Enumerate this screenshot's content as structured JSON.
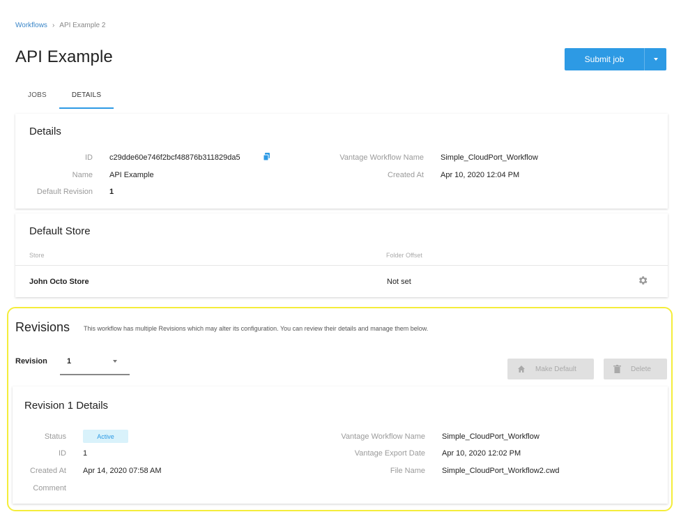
{
  "breadcrumb": {
    "parent": "Workflows",
    "separator": "›",
    "current": "API Example 2"
  },
  "page": {
    "title": "API Example"
  },
  "actions": {
    "submit_label": "Submit job"
  },
  "tabs": [
    {
      "label": "JOBS"
    },
    {
      "label": "DETAILS",
      "active": true
    }
  ],
  "details": {
    "title": "Details",
    "id_label": "ID",
    "id_value": "c29dde60e746f2bcf48876b311829da5",
    "name_label": "Name",
    "name_value": "API Example",
    "default_revision_label": "Default Revision",
    "default_revision_value": "1",
    "vantage_name_label": "Vantage Workflow Name",
    "vantage_name_value": "Simple_CloudPort_Workflow",
    "created_label": "Created At",
    "created_value": "Apr 10, 2020 12:04 PM"
  },
  "default_store": {
    "title": "Default Store",
    "col_store": "Store",
    "col_folder": "Folder Offset",
    "row": {
      "store": "John Octo Store",
      "folder_offset": "Not set"
    }
  },
  "revisions": {
    "title": "Revisions",
    "description": "This workflow has multiple Revisions which may alter its configuration. You can review their details and manage them below.",
    "select_label": "Revision",
    "selected": "1",
    "make_default_label": "Make Default",
    "delete_label": "Delete",
    "detail": {
      "title": "Revision 1 Details",
      "status_label": "Status",
      "status_value": "Active",
      "id_label": "ID",
      "id_value": "1",
      "created_label": "Created At",
      "created_value": "Apr 14, 2020 07:58 AM",
      "comment_label": "Comment",
      "vantage_name_label": "Vantage Workflow Name",
      "vantage_name_value": "Simple_CloudPort_Workflow",
      "export_label": "Vantage Export Date",
      "export_value": "Apr 10, 2020 12:02 PM",
      "file_label": "File Name",
      "file_value": "Simple_CloudPort_Workflow2.cwd"
    }
  },
  "colors": {
    "accent": "#2d9ae4",
    "highlight": "#f4ed3a",
    "badge_bg": "#d9f2fb"
  }
}
